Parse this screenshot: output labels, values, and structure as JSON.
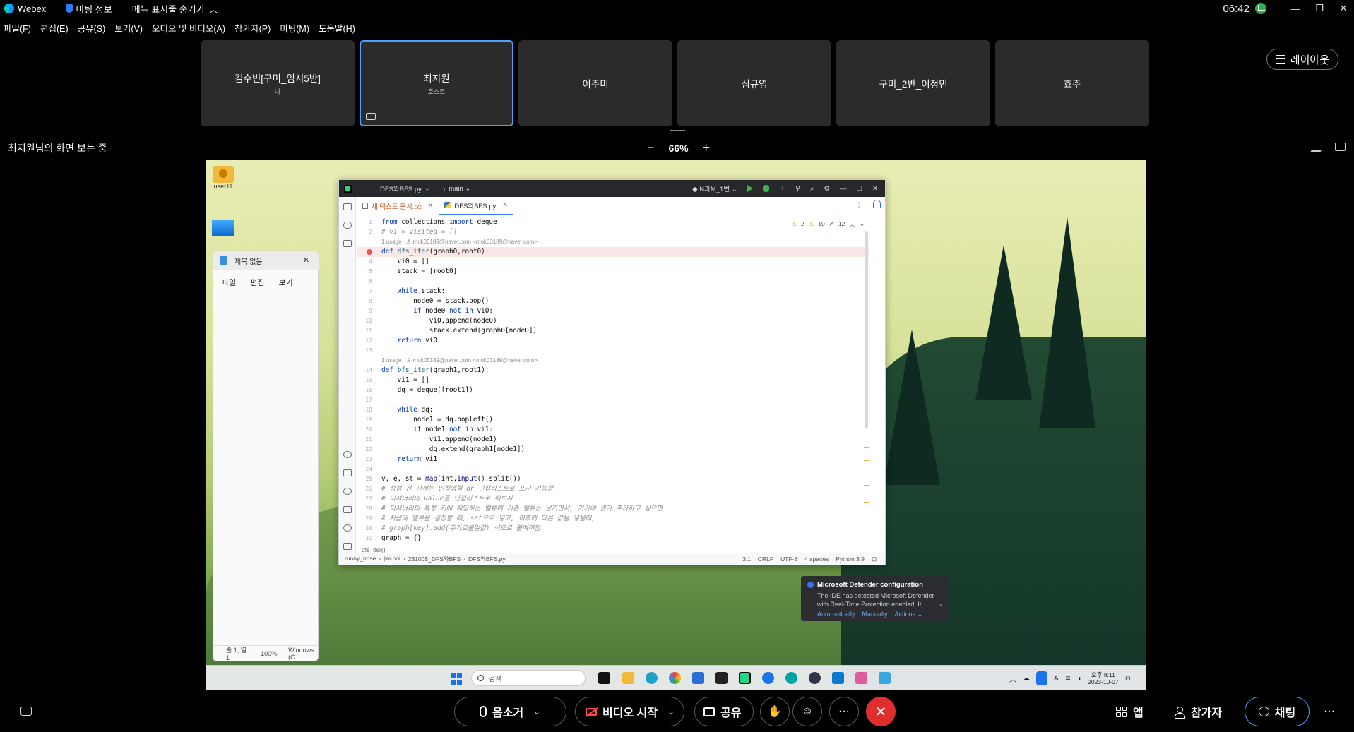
{
  "titlebar": {
    "app_name": "Webex",
    "meeting_info": "미팅 정보",
    "hide_menu": "메뉴 표시줄 숨기기",
    "clock": "06:42",
    "minimize": "—",
    "restore": "❐",
    "close": "✕"
  },
  "menu": [
    "파일(F)",
    "편집(E)",
    "공유(S)",
    "보기(V)",
    "오디오 및 비디오(A)",
    "참가자(P)",
    "미팅(M)",
    "도움말(H)"
  ],
  "participants": [
    {
      "name": "김수빈[구미_임시5반]",
      "role": "나"
    },
    {
      "name": "최지원",
      "role": "호스트"
    },
    {
      "name": "이주미",
      "role": ""
    },
    {
      "name": "심규영",
      "role": ""
    },
    {
      "name": "구미_2반_이정민",
      "role": ""
    },
    {
      "name": "효주",
      "role": ""
    }
  ],
  "layout_button": "레이아웃",
  "share": {
    "viewing_text": "최지원님의 화면 보는 중",
    "zoom": "66%",
    "zoom_out": "−",
    "zoom_in": "+"
  },
  "desktop": {
    "user_icon_label": "user11"
  },
  "notepad": {
    "tab_title": "제목 없음",
    "close": "✕",
    "menu": [
      "파일",
      "편집",
      "보기"
    ],
    "status": [
      "줄 1, 열 1",
      "100%",
      "Windows (C"
    ]
  },
  "ide": {
    "project": "DFS와BFS.py",
    "branch": "main",
    "run_config": "N과M_1번",
    "tabs": [
      {
        "label": "새 텍스트 문서.txt",
        "active": false
      },
      {
        "label": "DFS와BFS.py",
        "active": true
      }
    ],
    "inspections": {
      "warnings_major": "2",
      "warnings_minor": "10",
      "ok": "12"
    },
    "lines": [
      {
        "n": "1",
        "text": "from collections import deque",
        "type": "code"
      },
      {
        "n": "2",
        "text": "# vi = visited = []",
        "type": "comment"
      },
      {
        "n": "",
        "text": "1 usage   ♙ mok03189@naver.com <mok03189@naver.com>",
        "type": "hint"
      },
      {
        "n": "3",
        "text": "def dfs_iter(graph0,root0):",
        "type": "code",
        "bp": true
      },
      {
        "n": "4",
        "text": "    vi0 = []",
        "type": "code"
      },
      {
        "n": "5",
        "text": "    stack = [root0]",
        "type": "code"
      },
      {
        "n": "6",
        "text": "",
        "type": "code"
      },
      {
        "n": "7",
        "text": "    while stack:",
        "type": "code"
      },
      {
        "n": "8",
        "text": "        node0 = stack.pop()",
        "type": "code"
      },
      {
        "n": "9",
        "text": "        if node0 not in vi0:",
        "type": "code"
      },
      {
        "n": "10",
        "text": "            vi0.append(node0)",
        "type": "code"
      },
      {
        "n": "11",
        "text": "            stack.extend(graph0[node0])",
        "type": "code"
      },
      {
        "n": "12",
        "text": "    return vi0",
        "type": "code"
      },
      {
        "n": "13",
        "text": "",
        "type": "code"
      },
      {
        "n": "",
        "text": "1 usage   ♙ mok03189@naver.com <mok03189@naver.com>",
        "type": "hint"
      },
      {
        "n": "14",
        "text": "def bfs_iter(graph1,root1):",
        "type": "code"
      },
      {
        "n": "15",
        "text": "    vi1 = []",
        "type": "code"
      },
      {
        "n": "16",
        "text": "    dq = deque([root1])",
        "type": "code"
      },
      {
        "n": "17",
        "text": "",
        "type": "code"
      },
      {
        "n": "18",
        "text": "    while dq:",
        "type": "code"
      },
      {
        "n": "19",
        "text": "        node1 = dq.popleft()",
        "type": "code"
      },
      {
        "n": "20",
        "text": "        if node1 not in vi1:",
        "type": "code"
      },
      {
        "n": "21",
        "text": "            vi1.append(node1)",
        "type": "code"
      },
      {
        "n": "22",
        "text": "            dq.extend(graph1[node1])",
        "type": "code"
      },
      {
        "n": "23",
        "text": "    return vi1",
        "type": "code"
      },
      {
        "n": "24",
        "text": "",
        "type": "code"
      },
      {
        "n": "25",
        "text": "v, e, st = map(int,input().split())",
        "type": "code"
      },
      {
        "n": "26",
        "text": "# 정점 간 관계는 인접행렬 or 인접리스트로 표시 가능함",
        "type": "comment"
      },
      {
        "n": "27",
        "text": "# 딕셔너리의 value를 인접리스트로 해보자",
        "type": "comment"
      },
      {
        "n": "28",
        "text": "# 딕셔너리의 특정 키에 해당하는 밸류에 기존 밸류는 남기면서, 거기에 뭔가 추가하고 싶으면",
        "type": "comment"
      },
      {
        "n": "29",
        "text": "# 처음에 밸류를 설정할 때, set으로 넣고, 이후에 다른 값을 넣을때,",
        "type": "comment"
      },
      {
        "n": "30",
        "text": "# graph[key].add(추가로붙일값) 식으로 붙여야함.",
        "type": "comment"
      },
      {
        "n": "31",
        "text": "graph = {}",
        "type": "code"
      }
    ],
    "breadcrumb_fn": "dfs_iter()",
    "status_path": [
      "runny_nose",
      "jwchoi",
      "231005_DFS와BFS",
      "DFS와BFS.py"
    ],
    "status_right": [
      "3:1",
      "CRLF",
      "UTF-8",
      "4 spaces",
      "Python 3.9"
    ]
  },
  "toast": {
    "title": "Microsoft Defender configuration",
    "body": "The IDE has detected Microsoft Defender with Real-Time Protection enabled. It...",
    "links": [
      "Automatically",
      "Manually",
      "Actions ⌄"
    ]
  },
  "taskbar": {
    "search_placeholder": "검색",
    "tray_lang": "A",
    "time": "오후 8:11",
    "date": "2023-10-07"
  },
  "controls": {
    "mute": "음소거",
    "video": "비디오 시작",
    "share": "공유",
    "more": "···",
    "end": "✕",
    "apps": "앱",
    "participants": "참가자",
    "chat": "채팅",
    "overflow": "···"
  },
  "colors": {
    "active_tile_border": "#4aa3ff",
    "end_call": "#e02e2e",
    "breakpoint": "#e55757"
  }
}
